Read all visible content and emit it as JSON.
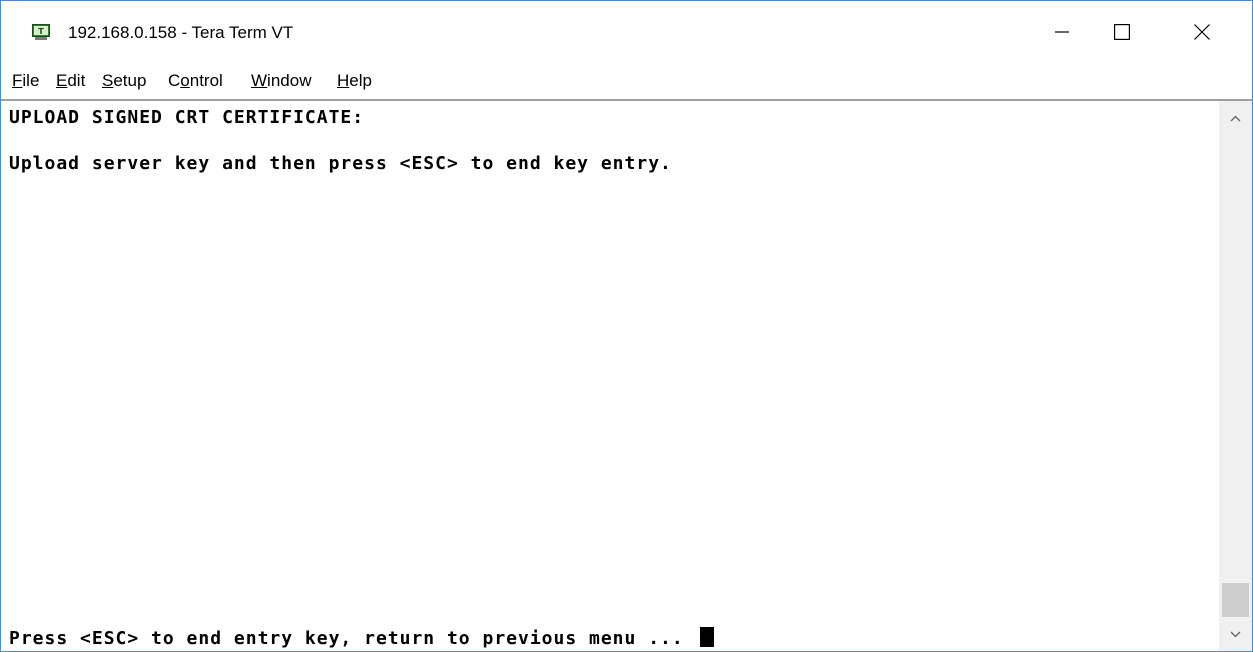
{
  "window": {
    "title": "192.168.0.158 - Tera Term VT"
  },
  "icons": {
    "app": "tera-term-icon",
    "minimize": "minimize-icon",
    "maximize": "maximize-icon",
    "close": "close-icon",
    "scroll_up": "chevron-up-icon",
    "scroll_down": "chevron-down-icon"
  },
  "menu": {
    "items": [
      {
        "pre": "",
        "key": "F",
        "post": "ile"
      },
      {
        "pre": "",
        "key": "E",
        "post": "dit"
      },
      {
        "pre": "",
        "key": "S",
        "post": "etup"
      },
      {
        "pre": "C",
        "key": "o",
        "post": "ntrol"
      },
      {
        "pre": "",
        "key": "W",
        "post": "indow"
      },
      {
        "pre": "",
        "key": "H",
        "post": "elp"
      }
    ]
  },
  "terminal": {
    "lines": [
      "UPLOAD SIGNED CRT CERTIFICATE:",
      "Upload server key and then press <ESC> to end key entry.",
      "Press <ESC> to end entry key, return to previous menu ... "
    ]
  },
  "colors": {
    "window_border": "#4a8ccf",
    "text": "#000000",
    "background": "#ffffff",
    "scrollbar_track": "#f0f0f0",
    "scrollbar_thumb": "#cdcdcd"
  }
}
